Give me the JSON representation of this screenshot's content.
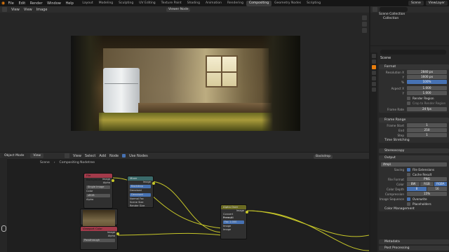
{
  "topbar": {
    "menu": [
      "File",
      "Edit",
      "Render",
      "Window",
      "Help"
    ],
    "tabs": [
      "Layout",
      "Modeling",
      "Sculpting",
      "UV Editing",
      "Texture Paint",
      "Shading",
      "Animation",
      "Rendering",
      "Compositing",
      "Geometry Nodes",
      "Scripting"
    ],
    "active_tab": "Compositing",
    "scene": "Scene",
    "view_layer": "ViewLayer"
  },
  "image_editor": {
    "menu": [
      "View",
      "View",
      "Image"
    ],
    "viewer_label": "Viewer Node"
  },
  "node_editor": {
    "mode": "Object Mode",
    "menu": [
      "View",
      "Select",
      "Add",
      "Node"
    ],
    "use_nodes_label": "Use Nodes",
    "breadcrumb": [
      "Scene",
      "Compositing Nodetree"
    ],
    "backdrop_label": "Backdrop",
    "nodes": {
      "file_output": {
        "title": "File Background.png",
        "rows": [
          "Image",
          "Alpha"
        ],
        "fields": [
          "Single Image",
          "Color",
          "sRGB",
          "Alpha",
          "Straight"
        ]
      },
      "mixer": {
        "title": "Mixer",
        "rows": [
          "Image"
        ],
        "options": [
          "Backdrop",
          "Denoised",
          "Denoised",
          "Normal Fac",
          "Scene Size",
          "Render Size"
        ]
      },
      "render_layers": {
        "title": "Render Layers",
        "rows": [
          "Image",
          "Alpha"
        ]
      },
      "alpha_over": {
        "title": "Alpha Over",
        "rows": [
          "Image",
          "Convert Premulti",
          "Premul",
          "Fac",
          "Image",
          "Image"
        ],
        "fac_value": "1.000"
      },
      "lower_node": {
        "title": "Viewport Color",
        "rows": [
          "Image",
          "Alpha"
        ],
        "field": "Passthrough"
      }
    }
  },
  "outliner": {
    "items": [
      "Scene Collection",
      "Collection"
    ]
  },
  "properties": {
    "search_placeholder": "",
    "scene_label": "Scene",
    "format": {
      "title": "Format",
      "resolution_x_label": "Resolution X",
      "resolution_x": "2840 px",
      "y_label": "Y",
      "resolution_y": "1600 px",
      "pct_label": "%",
      "percent": "100%",
      "aspect_x_label": "Aspect X",
      "aspect_x": "1.000",
      "aspect_y": "1.000",
      "render_region": "Render Region",
      "crop_region": "Crop to Render Region",
      "frame_rate_label": "Frame Rate",
      "frame_rate": "24 fps"
    },
    "frame_range": {
      "title": "Frame Range",
      "start_label": "Frame Start",
      "start": "1",
      "end_label": "End",
      "end": "250",
      "step_label": "Step",
      "step": "1"
    },
    "time_stretching": "Time Stretching",
    "stereoscopy": "Stereoscopy",
    "output": {
      "title": "Output",
      "path": "/tmp\\",
      "saving_label": "Saving",
      "file_extensions": "File Extensions",
      "cache_result": "Cache Result",
      "file_format_label": "File Format",
      "file_format": "PNG",
      "color_label": "Color",
      "color_modes": [
        "BW",
        "RGB",
        "RGBA"
      ],
      "color_active": "RGBA",
      "depth_label": "Color Depth",
      "depths": [
        "8",
        "16"
      ],
      "depth_active": "8",
      "compression_label": "Compression",
      "compression": "15%",
      "image_sequence_label": "Image Sequence",
      "overwrite": "Overwrite",
      "placeholders": "Placeholders",
      "color_management": "Color Management"
    },
    "metadata": "Metadata",
    "post_processing": "Post Processing"
  }
}
